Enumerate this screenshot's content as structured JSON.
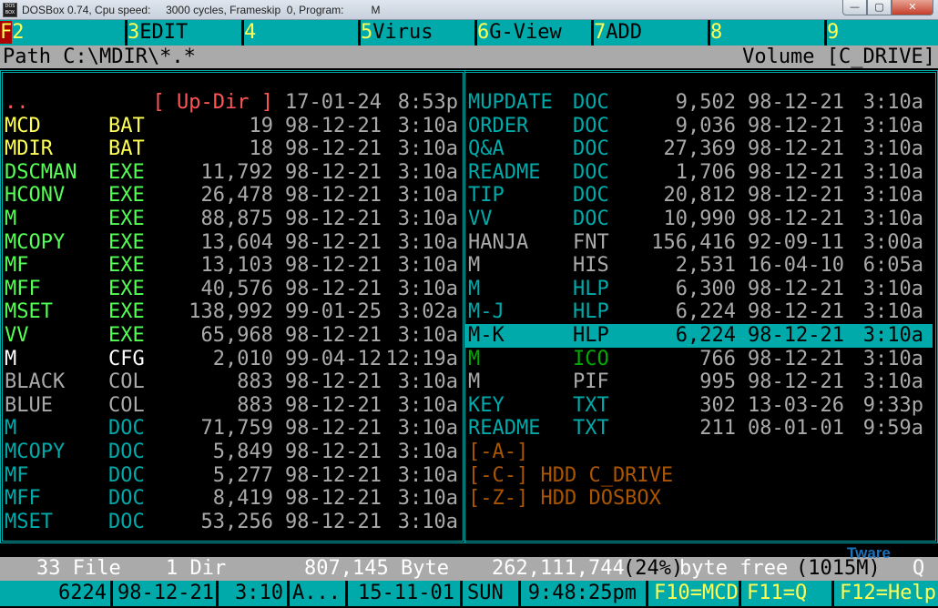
{
  "window": {
    "app_icon_text": "DOS BOX",
    "title": "DOSBox 0.74, Cpu speed:     3000 cycles, Frameskip  0, Program:         M",
    "buttons": {
      "minimize": "—",
      "maximize": "▢",
      "close": "✕"
    }
  },
  "function_keys": [
    {
      "num": "F",
      "num2": "2",
      "label": ""
    },
    {
      "num": "3",
      "label": "EDIT"
    },
    {
      "num": "4",
      "label": ""
    },
    {
      "num": "5",
      "label": "Virus"
    },
    {
      "num": "6",
      "label": "G-View"
    },
    {
      "num": "7",
      "label": "ADD"
    },
    {
      "num": "8",
      "label": ""
    },
    {
      "num": "9",
      "label": ""
    }
  ],
  "path_bar": {
    "path": "Path C:\\MDIR\\*.*",
    "volume": "Volume [C_DRIVE]"
  },
  "left_panel": [
    {
      "name": "..",
      "ext": "",
      "size": "[ Up-Dir ]",
      "date": "17-01-24",
      "time": "8:53p",
      "color": "#ff5555"
    },
    {
      "name": "MCD",
      "ext": "BAT",
      "size": "19",
      "date": "98-12-21",
      "time": "3:10a",
      "color": "#ffff55"
    },
    {
      "name": "MDIR",
      "ext": "BAT",
      "size": "18",
      "date": "98-12-21",
      "time": "3:10a",
      "color": "#ffff55"
    },
    {
      "name": "DSCMAN",
      "ext": "EXE",
      "size": "11,792",
      "date": "98-12-21",
      "time": "3:10a",
      "color": "#55ff55"
    },
    {
      "name": "HCONV",
      "ext": "EXE",
      "size": "26,478",
      "date": "98-12-21",
      "time": "3:10a",
      "color": "#55ff55"
    },
    {
      "name": "M",
      "ext": "EXE",
      "size": "88,875",
      "date": "98-12-21",
      "time": "3:10a",
      "color": "#55ff55"
    },
    {
      "name": "MCOPY",
      "ext": "EXE",
      "size": "13,604",
      "date": "98-12-21",
      "time": "3:10a",
      "color": "#55ff55"
    },
    {
      "name": "MF",
      "ext": "EXE",
      "size": "13,103",
      "date": "98-12-21",
      "time": "3:10a",
      "color": "#55ff55"
    },
    {
      "name": "MFF",
      "ext": "EXE",
      "size": "40,576",
      "date": "98-12-21",
      "time": "3:10a",
      "color": "#55ff55"
    },
    {
      "name": "MSET",
      "ext": "EXE",
      "size": "138,992",
      "date": "99-01-25",
      "time": "3:02a",
      "color": "#55ff55"
    },
    {
      "name": "VV",
      "ext": "EXE",
      "size": "65,968",
      "date": "98-12-21",
      "time": "3:10a",
      "color": "#55ff55"
    },
    {
      "name": "M",
      "ext": "CFG",
      "size": "2,010",
      "date": "99-04-12",
      "time": "12:19a",
      "color": "#ffffff"
    },
    {
      "name": "BLACK",
      "ext": "COL",
      "size": "883",
      "date": "98-12-21",
      "time": "3:10a",
      "color": "#aaaaaa"
    },
    {
      "name": "BLUE",
      "ext": "COL",
      "size": "883",
      "date": "98-12-21",
      "time": "3:10a",
      "color": "#aaaaaa"
    },
    {
      "name": "M",
      "ext": "DOC",
      "size": "71,759",
      "date": "98-12-21",
      "time": "3:10a",
      "color": "#00aaaa"
    },
    {
      "name": "MCOPY",
      "ext": "DOC",
      "size": "5,849",
      "date": "98-12-21",
      "time": "3:10a",
      "color": "#00aaaa"
    },
    {
      "name": "MF",
      "ext": "DOC",
      "size": "5,277",
      "date": "98-12-21",
      "time": "3:10a",
      "color": "#00aaaa"
    },
    {
      "name": "MFF",
      "ext": "DOC",
      "size": "8,419",
      "date": "98-12-21",
      "time": "3:10a",
      "color": "#00aaaa"
    },
    {
      "name": "MSET",
      "ext": "DOC",
      "size": "53,256",
      "date": "98-12-21",
      "time": "3:10a",
      "color": "#00aaaa"
    }
  ],
  "right_panel": [
    {
      "name": "MUPDATE",
      "ext": "DOC",
      "size": "9,502",
      "date": "98-12-21",
      "time": "3:10a",
      "color": "#00aaaa"
    },
    {
      "name": "ORDER",
      "ext": "DOC",
      "size": "9,036",
      "date": "98-12-21",
      "time": "3:10a",
      "color": "#00aaaa"
    },
    {
      "name": "Q&A",
      "ext": "DOC",
      "size": "27,369",
      "date": "98-12-21",
      "time": "3:10a",
      "color": "#00aaaa"
    },
    {
      "name": "README",
      "ext": "DOC",
      "size": "1,706",
      "date": "98-12-21",
      "time": "3:10a",
      "color": "#00aaaa"
    },
    {
      "name": "TIP",
      "ext": "DOC",
      "size": "20,812",
      "date": "98-12-21",
      "time": "3:10a",
      "color": "#00aaaa"
    },
    {
      "name": "VV",
      "ext": "DOC",
      "size": "10,990",
      "date": "98-12-21",
      "time": "3:10a",
      "color": "#00aaaa"
    },
    {
      "name": "HANJA",
      "ext": "FNT",
      "size": "156,416",
      "date": "92-09-11",
      "time": "3:00a",
      "color": "#aaaaaa"
    },
    {
      "name": "M",
      "ext": "HIS",
      "size": "2,531",
      "date": "16-04-10",
      "time": "6:05a",
      "color": "#aaaaaa"
    },
    {
      "name": "M",
      "ext": "HLP",
      "size": "6,300",
      "date": "98-12-21",
      "time": "3:10a",
      "color": "#00aaaa"
    },
    {
      "name": "M-J",
      "ext": "HLP",
      "size": "6,224",
      "date": "98-12-21",
      "time": "3:10a",
      "color": "#00aaaa"
    },
    {
      "name": "M-K",
      "ext": "HLP",
      "size": "6,224",
      "date": "98-12-21",
      "time": "3:10a",
      "color": "#000000",
      "selected": true
    },
    {
      "name": "M",
      "ext": "ICO",
      "size": "766",
      "date": "98-12-21",
      "time": "3:10a",
      "color": "#00aa00"
    },
    {
      "name": "M",
      "ext": "PIF",
      "size": "995",
      "date": "98-12-21",
      "time": "3:10a",
      "color": "#aaaaaa"
    },
    {
      "name": "KEY",
      "ext": "TXT",
      "size": "302",
      "date": "13-03-26",
      "time": "9:33p",
      "color": "#00aaaa"
    },
    {
      "name": "README",
      "ext": "TXT",
      "size": "211",
      "date": "08-01-01",
      "time": "9:59a",
      "color": "#00aaaa"
    },
    {
      "name": "[-A-]",
      "ext": "",
      "size": "",
      "date": "",
      "time": "",
      "color": "#aa5500"
    },
    {
      "name": "[-C-] HDD C_DRIVE",
      "ext": "",
      "size": "",
      "date": "",
      "time": "",
      "color": "#aa5500"
    },
    {
      "name": "[-Z-] HDD DOSBOX",
      "ext": "",
      "size": "",
      "date": "",
      "time": "",
      "color": "#aa5500"
    }
  ],
  "info_line": {
    "files": "33 File",
    "dirs": "1 Dir",
    "bytes": "807,145 Byte",
    "free_num": "262,111,744",
    "free_pct": "(24%)",
    "free_text": "byte free",
    "free_mb": "(1015M)",
    "tail": "Q"
  },
  "status_line": {
    "size": "6224",
    "date": "98-12-21",
    "time": "3:10",
    "attr": "A...",
    "today": "15-11-01",
    "weekday": "SUN",
    "clock": "9:48:25pm",
    "f10": "F10=MCD",
    "f11": "F11=Q",
    "f12": "F12=Help"
  },
  "watermark": "Tware",
  "colors": {
    "cyan": "#00aaaa",
    "gray": "#aaaaaa",
    "yellow": "#ffff55",
    "red": "#aa0000",
    "black": "#000000"
  }
}
